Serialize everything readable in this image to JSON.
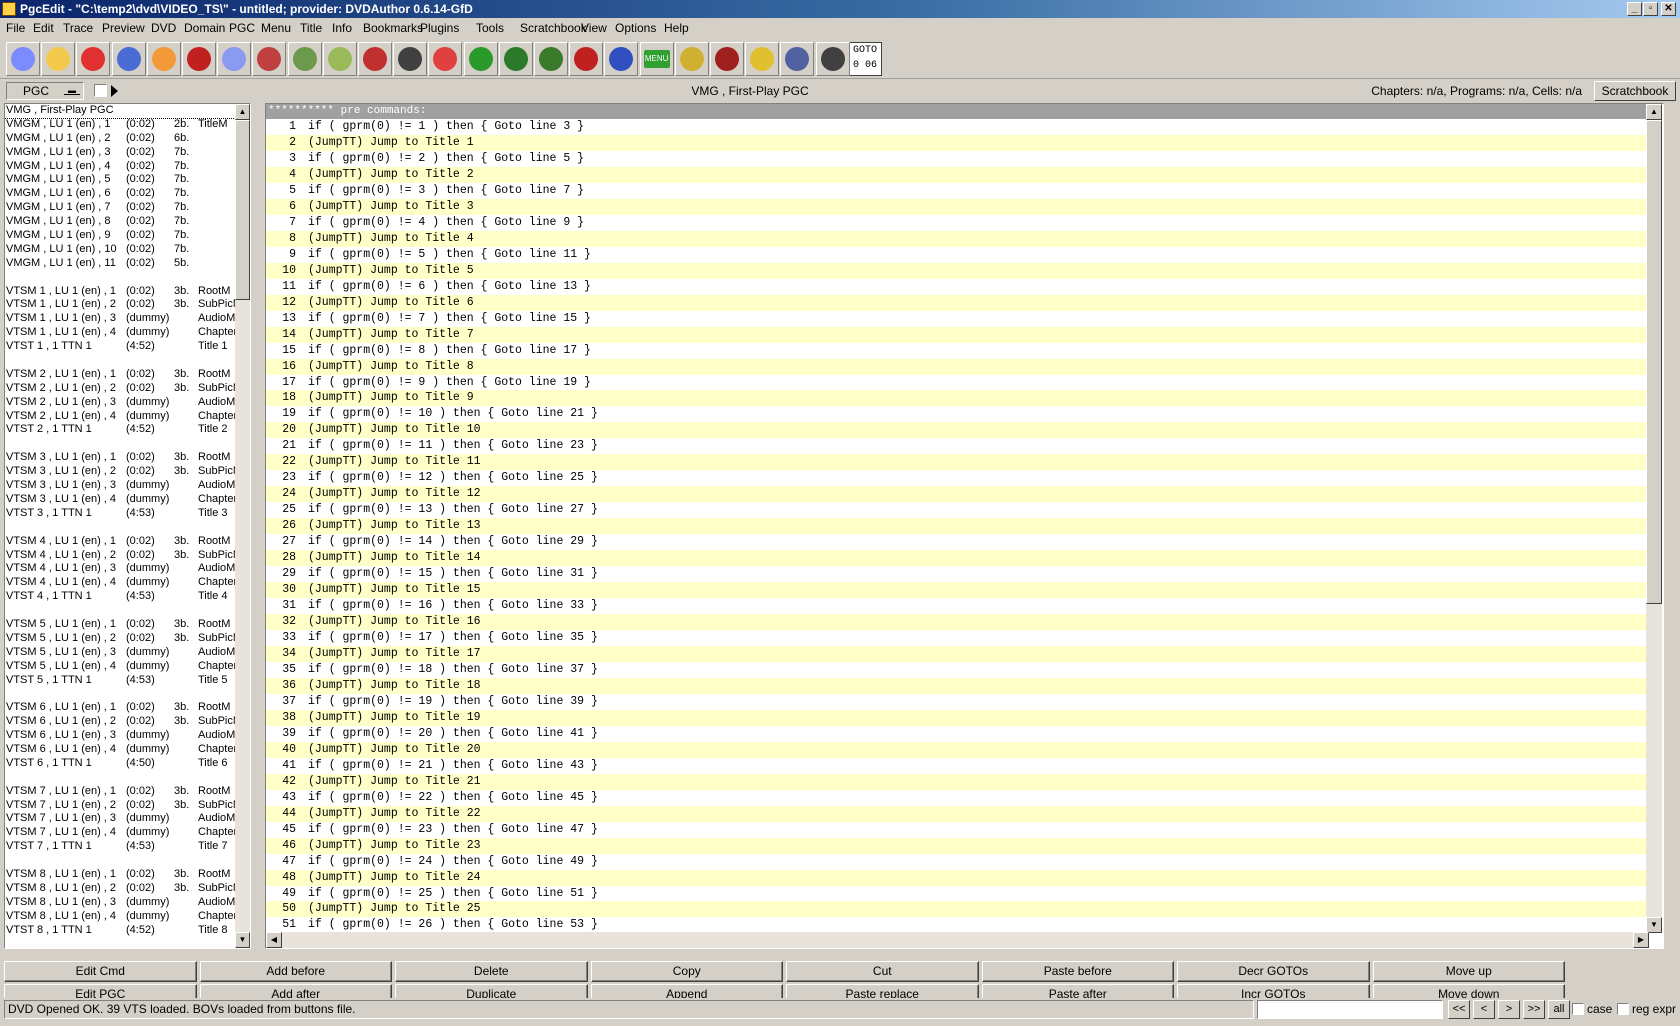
{
  "window": {
    "title": "PgcEdit -   \"C:\\temp2\\dvd\\VIDEO_TS\\\" - untitled; provider: DVDAuthor 0.6.14-GfD"
  },
  "menu": [
    "File",
    "Edit",
    "Trace",
    "Preview",
    "DVD",
    "Domain",
    "PGC",
    "Menu",
    "Title",
    "Info",
    "Bookmarks",
    "Plugins",
    "Tools",
    "Scratchbook",
    "View",
    "Options",
    "Help"
  ],
  "toolbar": {
    "icons": [
      "open-dvd-icon",
      "open-folder-icon",
      "reload-icon",
      "new-dvd-icon",
      "burn-icon",
      "search-icon",
      "disc-compare-icon",
      "disc-tools-icon",
      "edit-list-icon",
      "edit-note-icon",
      "check-icon",
      "camera-icon",
      "copy-doc-icon",
      "globe-icon",
      "play-preview-icon",
      "tools-icon",
      "list-red-icon",
      "delete-icon",
      "menu-icon",
      "chain-icon",
      "gprm-icon",
      "repeat-icon",
      "eye-icon",
      "jump-icon"
    ],
    "menu_label": "MENU",
    "goto_line1": "GOTO",
    "goto_line2": "0  06"
  },
  "pgcbar": {
    "selector": "PGC",
    "current_pgc": "VMG , First-Play PGC",
    "info": "Chapters: n/a,  Programs: n/a,  Cells: n/a",
    "scratchbook_button": "Scratchbook"
  },
  "pgc_list": [
    [
      "VMG , First-Play PGC",
      "",
      "",
      ""
    ],
    [
      "VMGM , LU 1 (en) , 1",
      "(0:02)",
      "2b.",
      "TitleM"
    ],
    [
      "VMGM , LU 1 (en) , 2",
      "(0:02)",
      "6b.",
      ""
    ],
    [
      "VMGM , LU 1 (en) , 3",
      "(0:02)",
      "7b.",
      ""
    ],
    [
      "VMGM , LU 1 (en) , 4",
      "(0:02)",
      "7b.",
      ""
    ],
    [
      "VMGM , LU 1 (en) , 5",
      "(0:02)",
      "7b.",
      ""
    ],
    [
      "VMGM , LU 1 (en) , 6",
      "(0:02)",
      "7b.",
      ""
    ],
    [
      "VMGM , LU 1 (en) , 7",
      "(0:02)",
      "7b.",
      ""
    ],
    [
      "VMGM , LU 1 (en) , 8",
      "(0:02)",
      "7b.",
      ""
    ],
    [
      "VMGM , LU 1 (en) , 9",
      "(0:02)",
      "7b.",
      ""
    ],
    [
      "VMGM , LU 1 (en) , 10",
      "(0:02)",
      "7b.",
      ""
    ],
    [
      "VMGM , LU 1 (en) , 11",
      "(0:02)",
      "5b.",
      ""
    ],
    [
      "",
      "",
      "",
      ""
    ],
    [
      "VTSM 1 , LU 1 (en) , 1",
      "(0:02)",
      "3b.",
      "RootM"
    ],
    [
      "VTSM 1 , LU 1 (en) , 2",
      "(0:02)",
      "3b.",
      "SubPicM"
    ],
    [
      "VTSM 1 , LU 1 (en) , 3",
      "(dummy)",
      "",
      "AudioM"
    ],
    [
      "VTSM 1 , LU 1 (en) , 4",
      "(dummy)",
      "",
      "ChapterM"
    ],
    [
      "VTST 1 , 1        TTN 1",
      "(4:52)",
      "",
      "Title 1"
    ],
    [
      "",
      "",
      "",
      ""
    ],
    [
      "VTSM 2 , LU 1 (en) , 1",
      "(0:02)",
      "3b.",
      "RootM"
    ],
    [
      "VTSM 2 , LU 1 (en) , 2",
      "(0:02)",
      "3b.",
      "SubPicM"
    ],
    [
      "VTSM 2 , LU 1 (en) , 3",
      "(dummy)",
      "",
      "AudioM"
    ],
    [
      "VTSM 2 , LU 1 (en) , 4",
      "(dummy)",
      "",
      "ChapterM"
    ],
    [
      "VTST 2 , 1        TTN 1",
      "(4:52)",
      "",
      "Title 2"
    ],
    [
      "",
      "",
      "",
      ""
    ],
    [
      "VTSM 3 , LU 1 (en) , 1",
      "(0:02)",
      "3b.",
      "RootM"
    ],
    [
      "VTSM 3 , LU 1 (en) , 2",
      "(0:02)",
      "3b.",
      "SubPicM"
    ],
    [
      "VTSM 3 , LU 1 (en) , 3",
      "(dummy)",
      "",
      "AudioM"
    ],
    [
      "VTSM 3 , LU 1 (en) , 4",
      "(dummy)",
      "",
      "ChapterM"
    ],
    [
      "VTST 3 , 1        TTN 1",
      "(4:53)",
      "",
      "Title 3"
    ],
    [
      "",
      "",
      "",
      ""
    ],
    [
      "VTSM 4 , LU 1 (en) , 1",
      "(0:02)",
      "3b.",
      "RootM"
    ],
    [
      "VTSM 4 , LU 1 (en) , 2",
      "(0:02)",
      "3b.",
      "SubPicM"
    ],
    [
      "VTSM 4 , LU 1 (en) , 3",
      "(dummy)",
      "",
      "AudioM"
    ],
    [
      "VTSM 4 , LU 1 (en) , 4",
      "(dummy)",
      "",
      "ChapterM"
    ],
    [
      "VTST 4 , 1        TTN 1",
      "(4:53)",
      "",
      "Title 4"
    ],
    [
      "",
      "",
      "",
      ""
    ],
    [
      "VTSM 5 , LU 1 (en) , 1",
      "(0:02)",
      "3b.",
      "RootM"
    ],
    [
      "VTSM 5 , LU 1 (en) , 2",
      "(0:02)",
      "3b.",
      "SubPicM"
    ],
    [
      "VTSM 5 , LU 1 (en) , 3",
      "(dummy)",
      "",
      "AudioM"
    ],
    [
      "VTSM 5 , LU 1 (en) , 4",
      "(dummy)",
      "",
      "ChapterM"
    ],
    [
      "VTST 5 , 1        TTN 1",
      "(4:53)",
      "",
      "Title 5"
    ],
    [
      "",
      "",
      "",
      ""
    ],
    [
      "VTSM 6 , LU 1 (en) , 1",
      "(0:02)",
      "3b.",
      "RootM"
    ],
    [
      "VTSM 6 , LU 1 (en) , 2",
      "(0:02)",
      "3b.",
      "SubPicM"
    ],
    [
      "VTSM 6 , LU 1 (en) , 3",
      "(dummy)",
      "",
      "AudioM"
    ],
    [
      "VTSM 6 , LU 1 (en) , 4",
      "(dummy)",
      "",
      "ChapterM"
    ],
    [
      "VTST 6 , 1        TTN 1",
      "(4:50)",
      "",
      "Title 6"
    ],
    [
      "",
      "",
      "",
      ""
    ],
    [
      "VTSM 7 , LU 1 (en) , 1",
      "(0:02)",
      "3b.",
      "RootM"
    ],
    [
      "VTSM 7 , LU 1 (en) , 2",
      "(0:02)",
      "3b.",
      "SubPicM"
    ],
    [
      "VTSM 7 , LU 1 (en) , 3",
      "(dummy)",
      "",
      "AudioM"
    ],
    [
      "VTSM 7 , LU 1 (en) , 4",
      "(dummy)",
      "",
      "ChapterM"
    ],
    [
      "VTST 7 , 1        TTN 1",
      "(4:53)",
      "",
      "Title 7"
    ],
    [
      "",
      "",
      "",
      ""
    ],
    [
      "VTSM 8 , LU 1 (en) , 1",
      "(0:02)",
      "3b.",
      "RootM"
    ],
    [
      "VTSM 8 , LU 1 (en) , 2",
      "(0:02)",
      "3b.",
      "SubPicM"
    ],
    [
      "VTSM 8 , LU 1 (en) , 3",
      "(dummy)",
      "",
      "AudioM"
    ],
    [
      "VTSM 8 , LU 1 (en) , 4",
      "(dummy)",
      "",
      "ChapterM"
    ],
    [
      "VTST 8 , 1        TTN 1",
      "(4:52)",
      "",
      "Title 8"
    ]
  ],
  "code": {
    "header": "********** pre commands:",
    "lines": [
      [
        "1",
        "if ( gprm(0) != 1 ) then { Goto line 3 }"
      ],
      [
        "2",
        "(JumpTT) Jump to Title 1"
      ],
      [
        "3",
        "if ( gprm(0) != 2 ) then { Goto line 5 }"
      ],
      [
        "4",
        "(JumpTT) Jump to Title 2"
      ],
      [
        "5",
        "if ( gprm(0) != 3 ) then { Goto line 7 }"
      ],
      [
        "6",
        "(JumpTT) Jump to Title 3"
      ],
      [
        "7",
        "if ( gprm(0) != 4 ) then { Goto line 9 }"
      ],
      [
        "8",
        "(JumpTT) Jump to Title 4"
      ],
      [
        "9",
        "if ( gprm(0) != 5 ) then { Goto line 11 }"
      ],
      [
        "10",
        "(JumpTT) Jump to Title 5"
      ],
      [
        "11",
        "if ( gprm(0) != 6 ) then { Goto line 13 }"
      ],
      [
        "12",
        "(JumpTT) Jump to Title 6"
      ],
      [
        "13",
        "if ( gprm(0) != 7 ) then { Goto line 15 }"
      ],
      [
        "14",
        "(JumpTT) Jump to Title 7"
      ],
      [
        "15",
        "if ( gprm(0) != 8 ) then { Goto line 17 }"
      ],
      [
        "16",
        "(JumpTT) Jump to Title 8"
      ],
      [
        "17",
        "if ( gprm(0) != 9 ) then { Goto line 19 }"
      ],
      [
        "18",
        "(JumpTT) Jump to Title 9"
      ],
      [
        "19",
        "if ( gprm(0) != 10 ) then { Goto line 21 }"
      ],
      [
        "20",
        "(JumpTT) Jump to Title 10"
      ],
      [
        "21",
        "if ( gprm(0) != 11 ) then { Goto line 23 }"
      ],
      [
        "22",
        "(JumpTT) Jump to Title 11"
      ],
      [
        "23",
        "if ( gprm(0) != 12 ) then { Goto line 25 }"
      ],
      [
        "24",
        "(JumpTT) Jump to Title 12"
      ],
      [
        "25",
        "if ( gprm(0) != 13 ) then { Goto line 27 }"
      ],
      [
        "26",
        "(JumpTT) Jump to Title 13"
      ],
      [
        "27",
        "if ( gprm(0) != 14 ) then { Goto line 29 }"
      ],
      [
        "28",
        "(JumpTT) Jump to Title 14"
      ],
      [
        "29",
        "if ( gprm(0) != 15 ) then { Goto line 31 }"
      ],
      [
        "30",
        "(JumpTT) Jump to Title 15"
      ],
      [
        "31",
        "if ( gprm(0) != 16 ) then { Goto line 33 }"
      ],
      [
        "32",
        "(JumpTT) Jump to Title 16"
      ],
      [
        "33",
        "if ( gprm(0) != 17 ) then { Goto line 35 }"
      ],
      [
        "34",
        "(JumpTT) Jump to Title 17"
      ],
      [
        "35",
        "if ( gprm(0) != 18 ) then { Goto line 37 }"
      ],
      [
        "36",
        "(JumpTT) Jump to Title 18"
      ],
      [
        "37",
        "if ( gprm(0) != 19 ) then { Goto line 39 }"
      ],
      [
        "38",
        "(JumpTT) Jump to Title 19"
      ],
      [
        "39",
        "if ( gprm(0) != 20 ) then { Goto line 41 }"
      ],
      [
        "40",
        "(JumpTT) Jump to Title 20"
      ],
      [
        "41",
        "if ( gprm(0) != 21 ) then { Goto line 43 }"
      ],
      [
        "42",
        "(JumpTT) Jump to Title 21"
      ],
      [
        "43",
        "if ( gprm(0) != 22 ) then { Goto line 45 }"
      ],
      [
        "44",
        "(JumpTT) Jump to Title 22"
      ],
      [
        "45",
        "if ( gprm(0) != 23 ) then { Goto line 47 }"
      ],
      [
        "46",
        "(JumpTT) Jump to Title 23"
      ],
      [
        "47",
        "if ( gprm(0) != 24 ) then { Goto line 49 }"
      ],
      [
        "48",
        "(JumpTT) Jump to Title 24"
      ],
      [
        "49",
        "if ( gprm(0) != 25 ) then { Goto line 51 }"
      ],
      [
        "50",
        "(JumpTT) Jump to Title 25"
      ],
      [
        "51",
        "if ( gprm(0) != 26 ) then { Goto line 53 }"
      ]
    ]
  },
  "buttons_row1": [
    "Edit Cmd",
    "Add before",
    "Delete",
    "Copy",
    "Cut",
    "Paste before",
    "Decr GOTOs",
    "Move up"
  ],
  "buttons_row2": [
    "Edit PGC",
    "Add after",
    "Duplicate",
    "Append",
    "Paste replace",
    "Paste after",
    "Incr GOTOs",
    "Move down"
  ],
  "status": {
    "text": "DVD Opened OK.   39 VTS loaded.   BOVs loaded from buttons file.",
    "search_value": "",
    "nav": [
      "<<",
      "<",
      ">",
      ">>",
      "all"
    ],
    "case_label": "case",
    "regexpr_label": "reg expr"
  },
  "colors": {
    "highlight_row": "#ffffc8",
    "header_bg": "#a0a0a0",
    "titlebar": "#0a246a"
  }
}
